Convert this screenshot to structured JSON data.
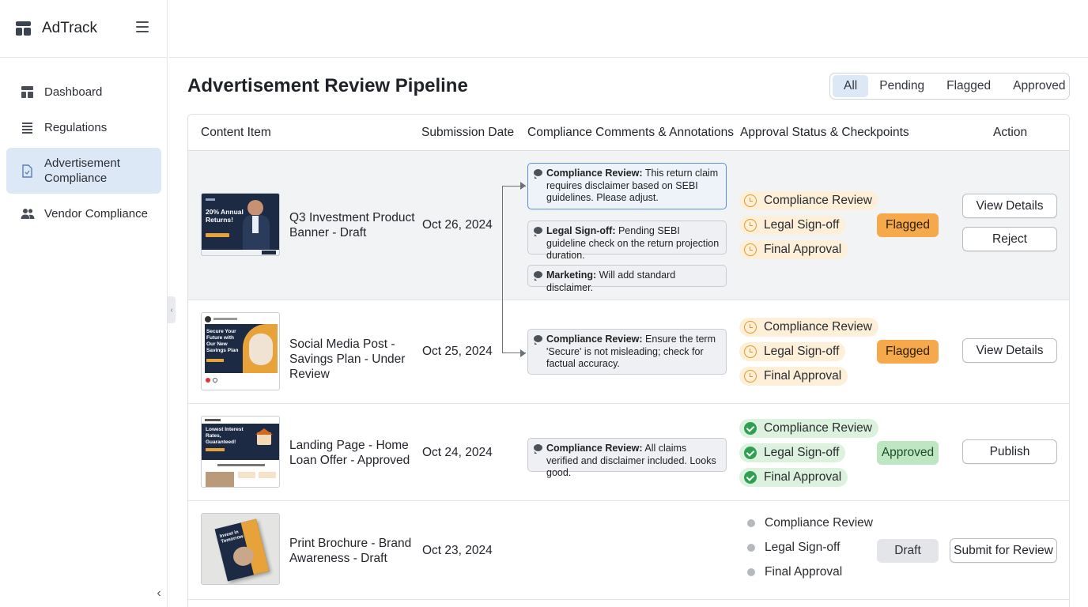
{
  "app": {
    "name": "AdTrack"
  },
  "sidebar": {
    "items": [
      {
        "label": "Dashboard",
        "icon": "dashboard-icon"
      },
      {
        "label": "Regulations",
        "icon": "list-icon"
      },
      {
        "label": "Advertisement Compliance",
        "icon": "document-icon",
        "active": true
      },
      {
        "label": "Vendor Compliance",
        "icon": "users-icon"
      }
    ]
  },
  "page": {
    "title": "Advertisement Review Pipeline"
  },
  "filters": {
    "options": [
      "All",
      "Pending",
      "Flagged",
      "Approved"
    ],
    "selected": "All"
  },
  "table": {
    "headers": [
      "Content Item",
      "Submission Date",
      "Compliance Comments & Annotations",
      "Approval Status & Checkpoints",
      "Action"
    ],
    "rows": [
      {
        "title": "Q3 Investment Product Banner - Draft",
        "thumb_text": "20% Annual Returns!",
        "date": "Oct 26, 2024",
        "comments": [
          {
            "author": "Compliance Review:",
            "text": " This return claim requires disclaimer based on SEBI guidelines. Please adjust."
          },
          {
            "author": "Legal Sign-off:",
            "text": " Pending SEBI guideline check on the return projection duration."
          },
          {
            "author": "Marketing:",
            "text": " Will add standard disclaimer."
          }
        ],
        "checkpoints": [
          "Compliance Review",
          "Legal Sign-off",
          "Final Approval"
        ],
        "checkpoint_state": "pending",
        "status": "Flagged",
        "actions": [
          "View Details",
          "Reject"
        ]
      },
      {
        "title": "Social Media Post - Savings Plan - Under Review",
        "thumb_text": "Secure Your Future with Our New Savings Plan",
        "date": "Oct 25, 2024",
        "comments": [
          {
            "author": "Compliance Review:",
            "text": " Ensure the term 'Secure' is not misleading; check for factual accuracy."
          }
        ],
        "checkpoints": [
          "Compliance Review",
          "Legal Sign-off",
          "Final Approval"
        ],
        "checkpoint_state": "pending",
        "status": "Flagged",
        "actions": [
          "View Details"
        ]
      },
      {
        "title": "Landing Page - Home Loan Offer - Approved",
        "thumb_text": "Lowest Interest Rates, Guaranteed!",
        "date": "Oct 24, 2024",
        "comments": [
          {
            "author": "Compliance Review:",
            "text": " All claims verified and disclaimer included. Looks good."
          }
        ],
        "checkpoints": [
          "Compliance Review",
          "Legal Sign-off",
          "Final Approval"
        ],
        "checkpoint_state": "done",
        "status": "Approved",
        "actions": [
          "Publish"
        ]
      },
      {
        "title": "Print Brochure - Brand Awareness - Draft",
        "thumb_text": "Invest in Tomorrow",
        "date": "Oct 23, 2024",
        "comments": [],
        "checkpoints": [
          "Compliance Review",
          "Legal Sign-off",
          "Final Approval"
        ],
        "checkpoint_state": "none",
        "status": "Draft",
        "actions": [
          "Submit for Review"
        ]
      }
    ]
  },
  "colors": {
    "accent": "#dde8f7",
    "flagged": "#f6a94a",
    "approved": "#bfe6c3",
    "pending": "#e39722",
    "done": "#2ea04f",
    "navy": "#1c2a44"
  }
}
